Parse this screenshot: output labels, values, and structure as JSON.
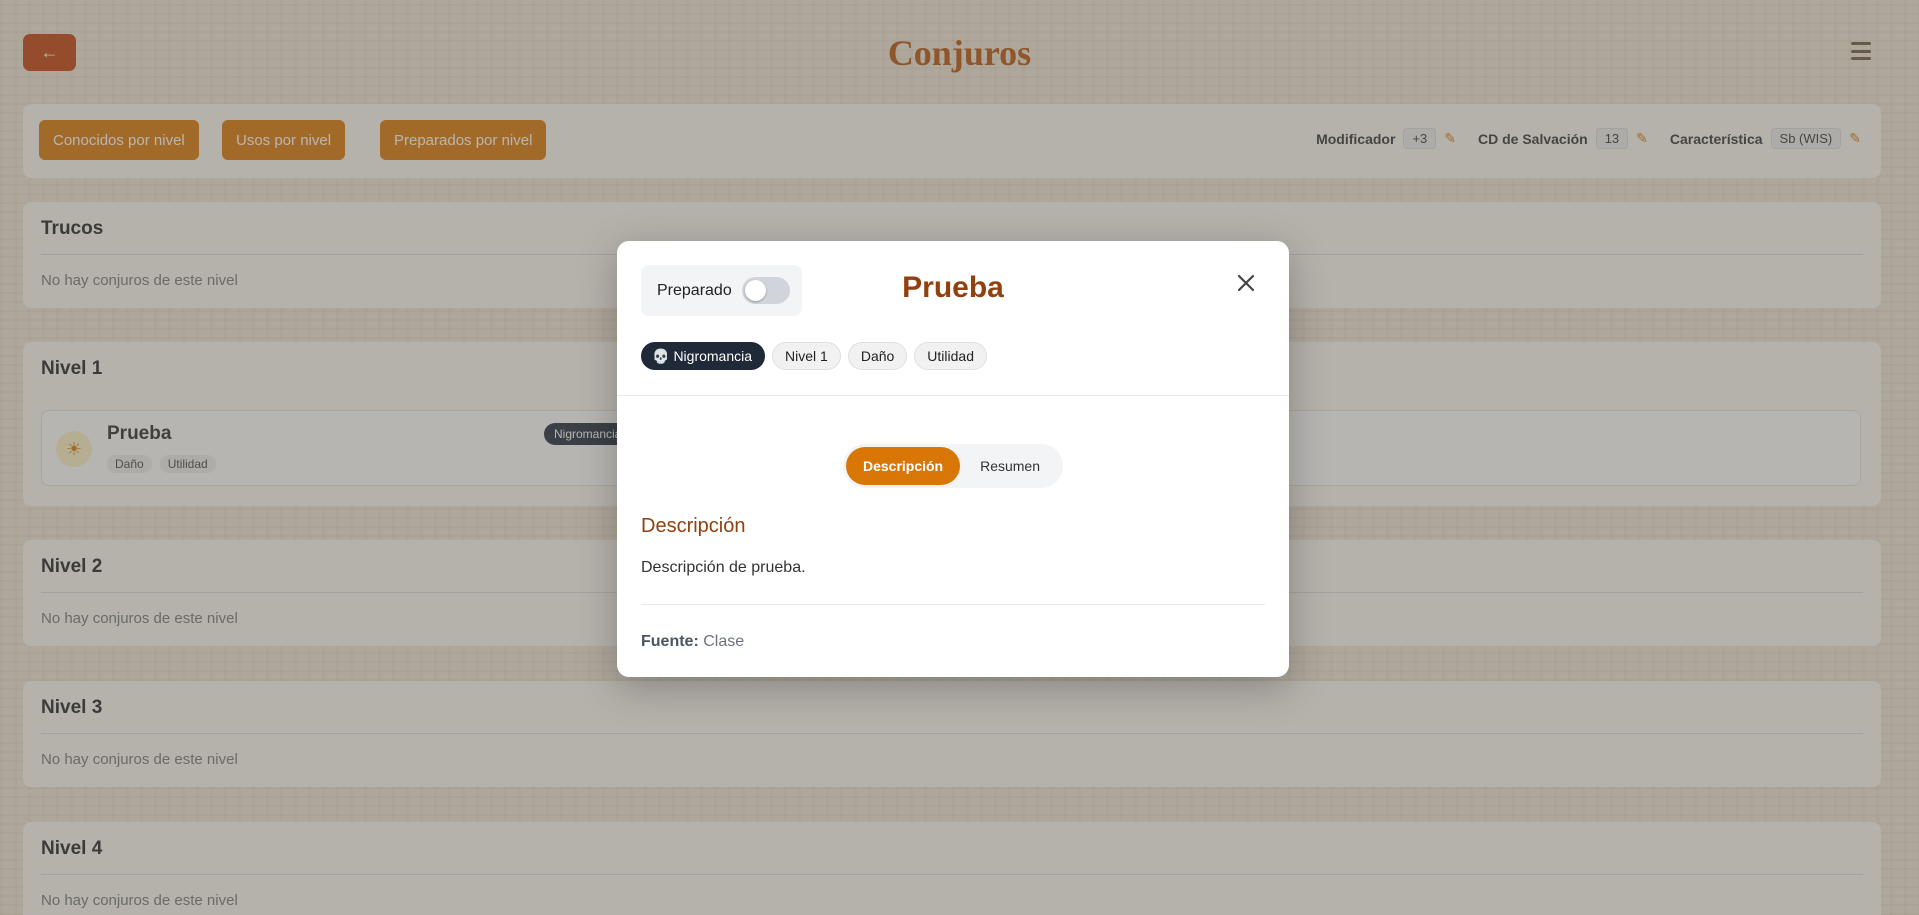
{
  "header": {
    "back_icon": "arrow-left-icon",
    "title": "Conjuros",
    "menu_icon": "hamburger-icon"
  },
  "toolbar": {
    "buttons": [
      "Conocidos por nivel",
      "Usos por nivel",
      "Preparados por nivel"
    ],
    "modifier_label": "Modificador",
    "modifier_value": "+3",
    "dc_label": "CD de Salvación",
    "dc_value": "13",
    "ability_label": "Característica",
    "ability_value": "Sb (WIS)"
  },
  "sections": [
    {
      "title": "Trucos",
      "empty": "No hay conjuros de este nivel"
    },
    {
      "title": "Nivel 1",
      "spell": {
        "name": "Prueba",
        "tags": [
          "Daño",
          "Utilidad"
        ],
        "school": "Nigromancia",
        "prepared": "No"
      }
    },
    {
      "title": "Nivel 2",
      "empty": "No hay conjuros de este nivel"
    },
    {
      "title": "Nivel 3",
      "empty": "No hay conjuros de este nivel"
    },
    {
      "title": "Nivel 4",
      "empty": "No hay conjuros de este nivel"
    }
  ],
  "modal": {
    "prepared_label": "Preparado",
    "prepared_on": false,
    "title": "Prueba",
    "close_icon": "close-icon",
    "chips": {
      "school": "Nigromancia",
      "level": "Nivel 1",
      "tag1": "Daño",
      "tag2": "Utilidad"
    },
    "tabs": {
      "active": "Descripción",
      "other": "Resumen"
    },
    "section_heading": "Descripción",
    "description": "Descripción de prueba.",
    "source_label": "Fuente:",
    "source_value": "Clase"
  },
  "colors": {
    "accent": "#d97706",
    "title_brown": "#92400e",
    "dark_chip": "#1f2937"
  }
}
